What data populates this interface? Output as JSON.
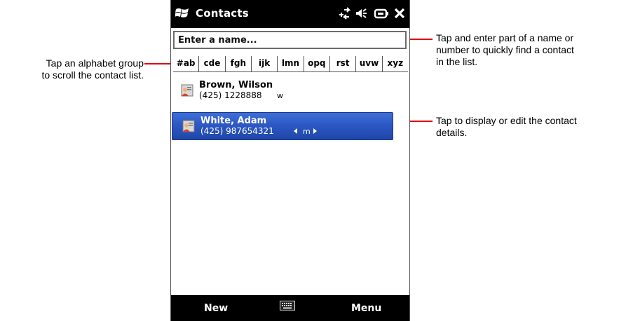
{
  "app": {
    "title": "Contacts",
    "status_icons": [
      "data-sync-icon",
      "volume-icon",
      "battery-icon",
      "close-icon"
    ]
  },
  "search": {
    "placeholder": "Enter a name..."
  },
  "alphabet_groups": [
    "#ab",
    "cde",
    "fgh",
    "ijk",
    "lmn",
    "opq",
    "rst",
    "uvw",
    "xyz"
  ],
  "contacts": [
    {
      "name": "Brown, Wilson",
      "phone": "(425) 1228888",
      "tag": "w",
      "selected": false
    },
    {
      "name": "White, Adam",
      "phone": "(425) 987654321",
      "tag": "m",
      "selected": true
    }
  ],
  "softkeys": {
    "left": "New",
    "right": "Menu",
    "middle_icon": "keyboard-icon"
  },
  "annotations": {
    "alphabet": [
      "Tap an alphabet group",
      "to scroll the contact list."
    ],
    "search": [
      "Tap and enter part of a name or",
      "number to quickly find a contact",
      "in the list."
    ],
    "contact": [
      "Tap to display or edit the contact",
      "details."
    ]
  },
  "colors": {
    "callout": "#e00000",
    "selection": "#2d58c4",
    "bars": "#000000"
  }
}
